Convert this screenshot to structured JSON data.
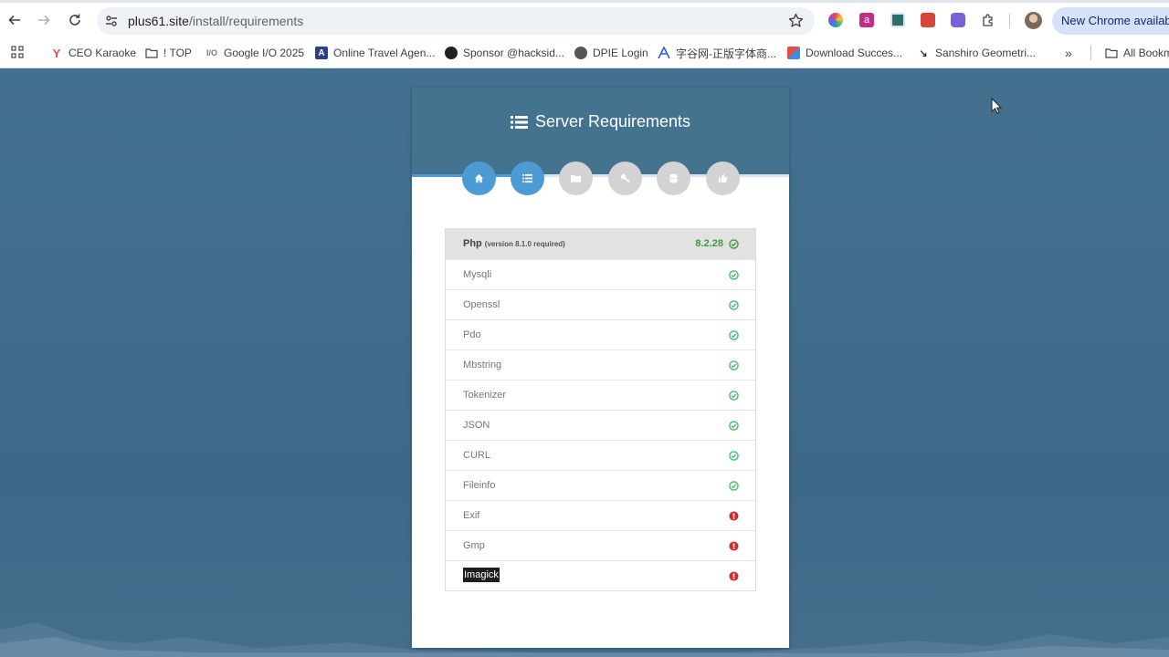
{
  "browser": {
    "url_host": "plus61.site",
    "url_path": "/install/requirements",
    "update_button": "New Chrome availabl"
  },
  "bookmarks": [
    {
      "label": "CEO Karaoke",
      "icon": "cocktail-icon"
    },
    {
      "label": "! TOP",
      "icon": "folder-icon"
    },
    {
      "label": "Google I/O 2025",
      "icon": "google-io-icon"
    },
    {
      "label": "Online Travel Agen...",
      "icon": "travel-icon"
    },
    {
      "label": "Sponsor @hacksid...",
      "icon": "github-icon"
    },
    {
      "label": "DPIE Login",
      "icon": "globe-icon"
    },
    {
      "label": "字谷网-正版字体商...",
      "icon": "font-site-icon"
    },
    {
      "label": "Download Succes...",
      "icon": "download-icon"
    },
    {
      "label": "Sanshiro Geometri...",
      "icon": "arrow-icon"
    },
    {
      "label": "All Bookm",
      "icon": "folder-icon"
    }
  ],
  "installer": {
    "title": "Server Requirements",
    "steps": [
      {
        "icon": "home-icon",
        "state": "active"
      },
      {
        "icon": "list-icon",
        "state": "active"
      },
      {
        "icon": "folder-icon",
        "state": "inactive"
      },
      {
        "icon": "key-icon",
        "state": "inactive"
      },
      {
        "icon": "database-icon",
        "state": "inactive"
      },
      {
        "icon": "thumbs-up-icon",
        "state": "inactive"
      }
    ],
    "php": {
      "name": "Php",
      "note": "(version 8.1.0 required)",
      "version": "8.2.28",
      "status": "ok"
    },
    "extensions": [
      {
        "name": "Mysqli",
        "status": "ok"
      },
      {
        "name": "Openssl",
        "status": "ok"
      },
      {
        "name": "Pdo",
        "status": "ok"
      },
      {
        "name": "Mbstring",
        "status": "ok"
      },
      {
        "name": "Tokenizer",
        "status": "ok"
      },
      {
        "name": "JSON",
        "status": "ok"
      },
      {
        "name": "CURL",
        "status": "ok"
      },
      {
        "name": "Fileinfo",
        "status": "ok"
      },
      {
        "name": "Exif",
        "status": "error"
      },
      {
        "name": "Gmp",
        "status": "error"
      },
      {
        "name": "Imagick",
        "status": "error"
      }
    ]
  },
  "colors": {
    "ok": "#3cc06a",
    "error": "#c9302c",
    "step_active": "#4d9bd4",
    "step_inactive": "#d3d3d3",
    "header_bg": "#44738f"
  }
}
